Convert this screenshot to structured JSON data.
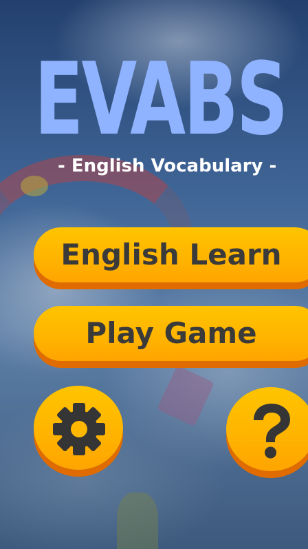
{
  "app": {
    "title": "EVABS",
    "subtitle": "- English Vocabulary -"
  },
  "menu": {
    "english_learn_label": "English Learn",
    "play_game_label": "Play Game"
  },
  "icons": {
    "settings": "gear-icon",
    "help": "question-mark-icon"
  },
  "colors": {
    "title": "#8fb3ff",
    "button": "#ffb300",
    "button_shadow": "#e06b00",
    "button_text": "#3a3a3a",
    "subtitle": "#ffffff"
  }
}
